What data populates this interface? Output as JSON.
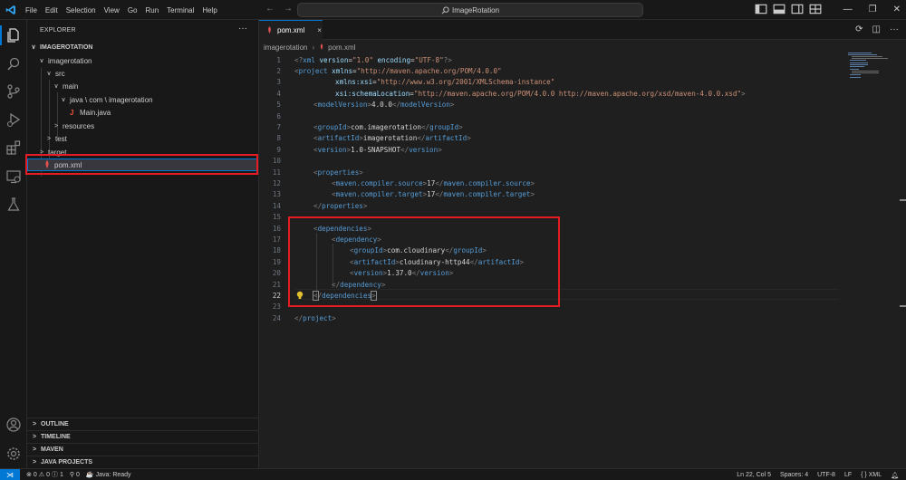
{
  "window": {
    "menu": [
      "File",
      "Edit",
      "Selection",
      "View",
      "Go",
      "Run",
      "Terminal",
      "Help"
    ],
    "search_text": "ImageRotation",
    "accent_color": "#0078d4"
  },
  "activity_bar": {
    "icons": [
      "explorer-icon",
      "search-icon",
      "source-control-icon",
      "run-debug-icon",
      "extensions-icon",
      "remote-explorer-icon",
      "testing-icon",
      "account-icon",
      "settings-gear-icon"
    ]
  },
  "sidebar": {
    "title": "EXPLORER",
    "more": "···",
    "root": "IMAGEROTATION",
    "tree": [
      {
        "label": "imagerotation",
        "chevron": "∨"
      },
      {
        "label": "src",
        "chevron": "∨"
      },
      {
        "label": "main",
        "chevron": "∨"
      },
      {
        "label": "java \\ com \\ imagerotation",
        "chevron": "∨"
      },
      {
        "label": "Main.java",
        "chevron": "",
        "icon": "J"
      },
      {
        "label": "resources",
        "chevron": ">"
      },
      {
        "label": "test",
        "chevron": ">"
      },
      {
        "label": "target",
        "chevron": ">"
      },
      {
        "label": "pom.xml",
        "chevron": ""
      }
    ],
    "panels": [
      "OUTLINE",
      "TIMELINE",
      "MAVEN",
      "JAVA PROJECTS"
    ]
  },
  "editor": {
    "tab_label": "pom.xml",
    "tab_close": "×",
    "breadcrumb": [
      "imagerotation",
      "pom.xml"
    ],
    "active_line": 22,
    "lines": [
      {
        "n": "1"
      },
      {
        "n": "2"
      },
      {
        "n": "3"
      },
      {
        "n": "4"
      },
      {
        "n": "5"
      },
      {
        "n": "6"
      },
      {
        "n": "7"
      },
      {
        "n": "8"
      },
      {
        "n": "9"
      },
      {
        "n": "10"
      },
      {
        "n": "11"
      },
      {
        "n": "12"
      },
      {
        "n": "13"
      },
      {
        "n": "14"
      },
      {
        "n": "15"
      },
      {
        "n": "16"
      },
      {
        "n": "17"
      },
      {
        "n": "18"
      },
      {
        "n": "19"
      },
      {
        "n": "20"
      },
      {
        "n": "21"
      },
      {
        "n": "22"
      },
      {
        "n": "23"
      },
      {
        "n": "24"
      }
    ],
    "code": {
      "l1_pi_open": "<?",
      "l1_xml": "xml",
      "l1_version_attr": "version",
      "l1_version_val": "\"1.0\"",
      "l1_encoding_attr": "encoding",
      "l1_encoding_val": "\"UTF-8\"",
      "l1_pi_close": "?>",
      "project": "project",
      "xmlns_attr": "xmlns",
      "xmlns_val": "\"http://maven.apache.org/POM/4.0.0\"",
      "xsi_attr": "xmlns:xsi",
      "xsi_val": "\"http://www.w3.org/2001/XMLSchema-instance\"",
      "schema_attr": "xsi:schemaLocation",
      "schema_val_1": "\"http://maven.apache.org/POM/4.0.0",
      "schema_val_2": "http://maven.apache.org/xsd/maven-4.0.0.xsd\"",
      "modelVersion": "modelVersion",
      "modelVersion_val": "4.0.0",
      "groupId": "groupId",
      "groupId_val": "com.imagerotation",
      "artifactId": "artifactId",
      "artifactId_val": "imagerotation",
      "version": "version",
      "version_val": "1.0-SNAPSHOT",
      "properties": "properties",
      "src_prop": "maven.compiler.source",
      "tgt_prop": "maven.compiler.target",
      "java_ver": "17",
      "dependencies": "dependencies",
      "dependency": "dependency",
      "dep_group": "com.cloudinary",
      "dep_artifact": "cloudinary-http44",
      "dep_version": "1.37.0"
    }
  },
  "statusbar": {
    "remote": "⋊",
    "errors": "0",
    "warnings": "0",
    "info": "1",
    "ports": "0",
    "java": "Java: Ready",
    "position": "Ln 22, Col 5",
    "spaces": "Spaces: 4",
    "encoding": "UTF-8",
    "eol": "LF",
    "language": "XML"
  }
}
